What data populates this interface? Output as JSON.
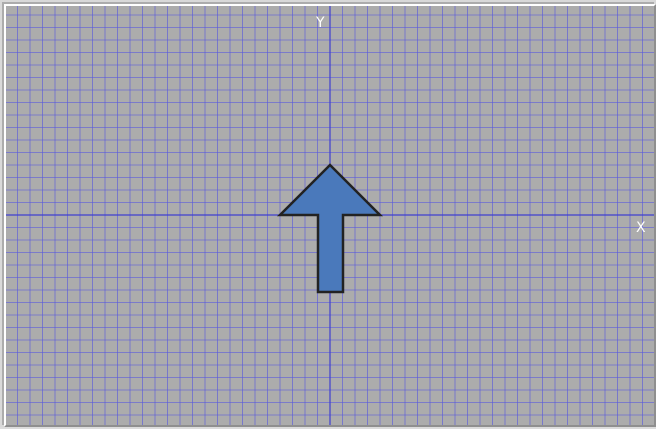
{
  "graph": {
    "x_axis_label": "X",
    "y_axis_label": "Y"
  },
  "colors": {
    "background": "#acacac",
    "grid_line": "#5b5bdc",
    "axis_line": "#3f3fd0",
    "shape_fill": "#4a79bb",
    "shape_stroke": "#222222",
    "label": "#ffffff"
  },
  "shape": {
    "type": "up-arrow"
  }
}
